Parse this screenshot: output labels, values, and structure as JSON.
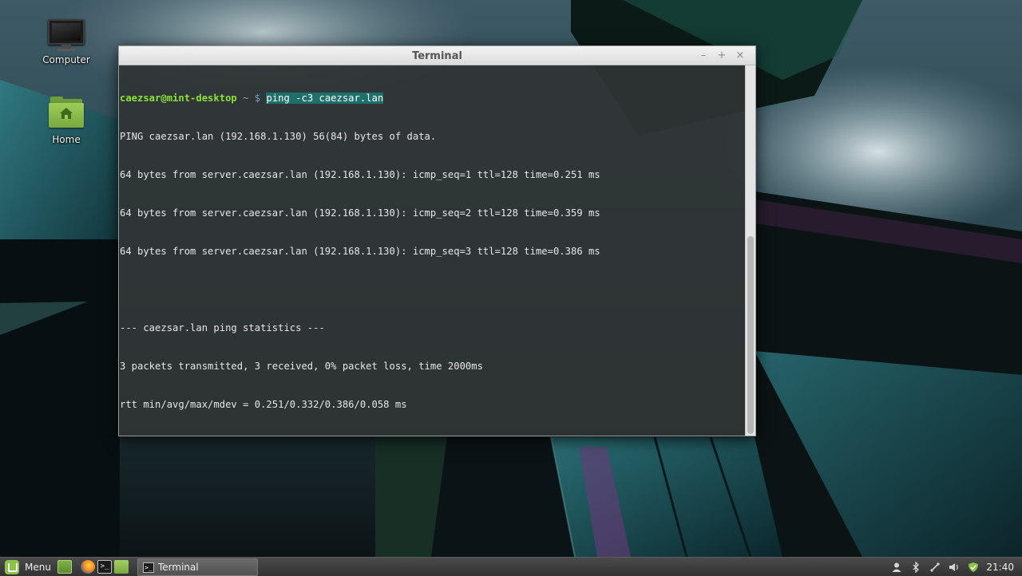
{
  "desktop": {
    "icons": [
      {
        "label": "Computer",
        "icon": "computer-icon"
      },
      {
        "label": "Home",
        "icon": "home-folder-icon"
      }
    ]
  },
  "window": {
    "title": "Terminal",
    "controls": {
      "minimize": "–",
      "maximize": "+",
      "close": "×"
    }
  },
  "terminal": {
    "prompt_user": "caezsar@mint-desktop",
    "prompt_sep": " ~ ",
    "prompt_symbol": "$",
    "command": "ping -c3 caezsar.lan",
    "output": [
      "PING caezsar.lan (192.168.1.130) 56(84) bytes of data.",
      "64 bytes from server.caezsar.lan (192.168.1.130): icmp_seq=1 ttl=128 time=0.251 ms",
      "64 bytes from server.caezsar.lan (192.168.1.130): icmp_seq=2 ttl=128 time=0.359 ms",
      "64 bytes from server.caezsar.lan (192.168.1.130): icmp_seq=3 ttl=128 time=0.386 ms",
      "",
      "--- caezsar.lan ping statistics ---",
      "3 packets transmitted, 3 received, 0% packet loss, time 2000ms",
      "rtt min/avg/max/mdev = 0.251/0.332/0.386/0.058 ms"
    ]
  },
  "panel": {
    "menu_label": "Menu",
    "launchers": [
      "show-desktop-icon",
      "firefox-icon",
      "terminal-icon",
      "files-icon"
    ],
    "tasks": [
      {
        "label": "Terminal",
        "icon": "terminal-icon"
      }
    ],
    "tray_icons": [
      "user-icon",
      "bluetooth-icon",
      "network-icon",
      "volume-icon",
      "update-shield-icon"
    ],
    "clock": "21:40"
  }
}
